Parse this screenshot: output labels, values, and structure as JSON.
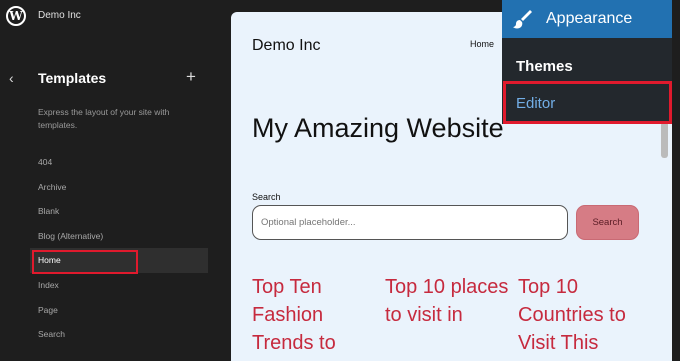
{
  "sidebar": {
    "site_name": "Demo Inc",
    "back_icon": "chevron-left-icon",
    "title": "Templates",
    "add_icon": "plus-icon",
    "description": "Express the layout of your site with templates.",
    "templates": [
      "404",
      "Archive",
      "Blank",
      "Blog (Alternative)",
      "Home",
      "Index",
      "Page",
      "Search"
    ],
    "active_template": "Home"
  },
  "canvas": {
    "site_title": "Demo Inc",
    "nav": {
      "home": "Home"
    },
    "hero_title": "My Amazing Website",
    "search": {
      "label": "Search",
      "placeholder": "Optional placeholder...",
      "button": "Search"
    },
    "posts": [
      "Top Ten Fashion Trends to",
      "Top 10 places to visit in",
      "Top 10 Countries to Visit This"
    ]
  },
  "admin_menu": {
    "appearance_label": "Appearance",
    "items": [
      "Themes",
      "Editor"
    ],
    "highlighted_item": "Editor"
  },
  "colors": {
    "sidebar_bg": "#1e1e1e",
    "canvas_bg": "#eaf3fc",
    "admin_blue": "#2271b1",
    "highlight_red": "#e01a2d",
    "post_title": "#c62a3e"
  }
}
